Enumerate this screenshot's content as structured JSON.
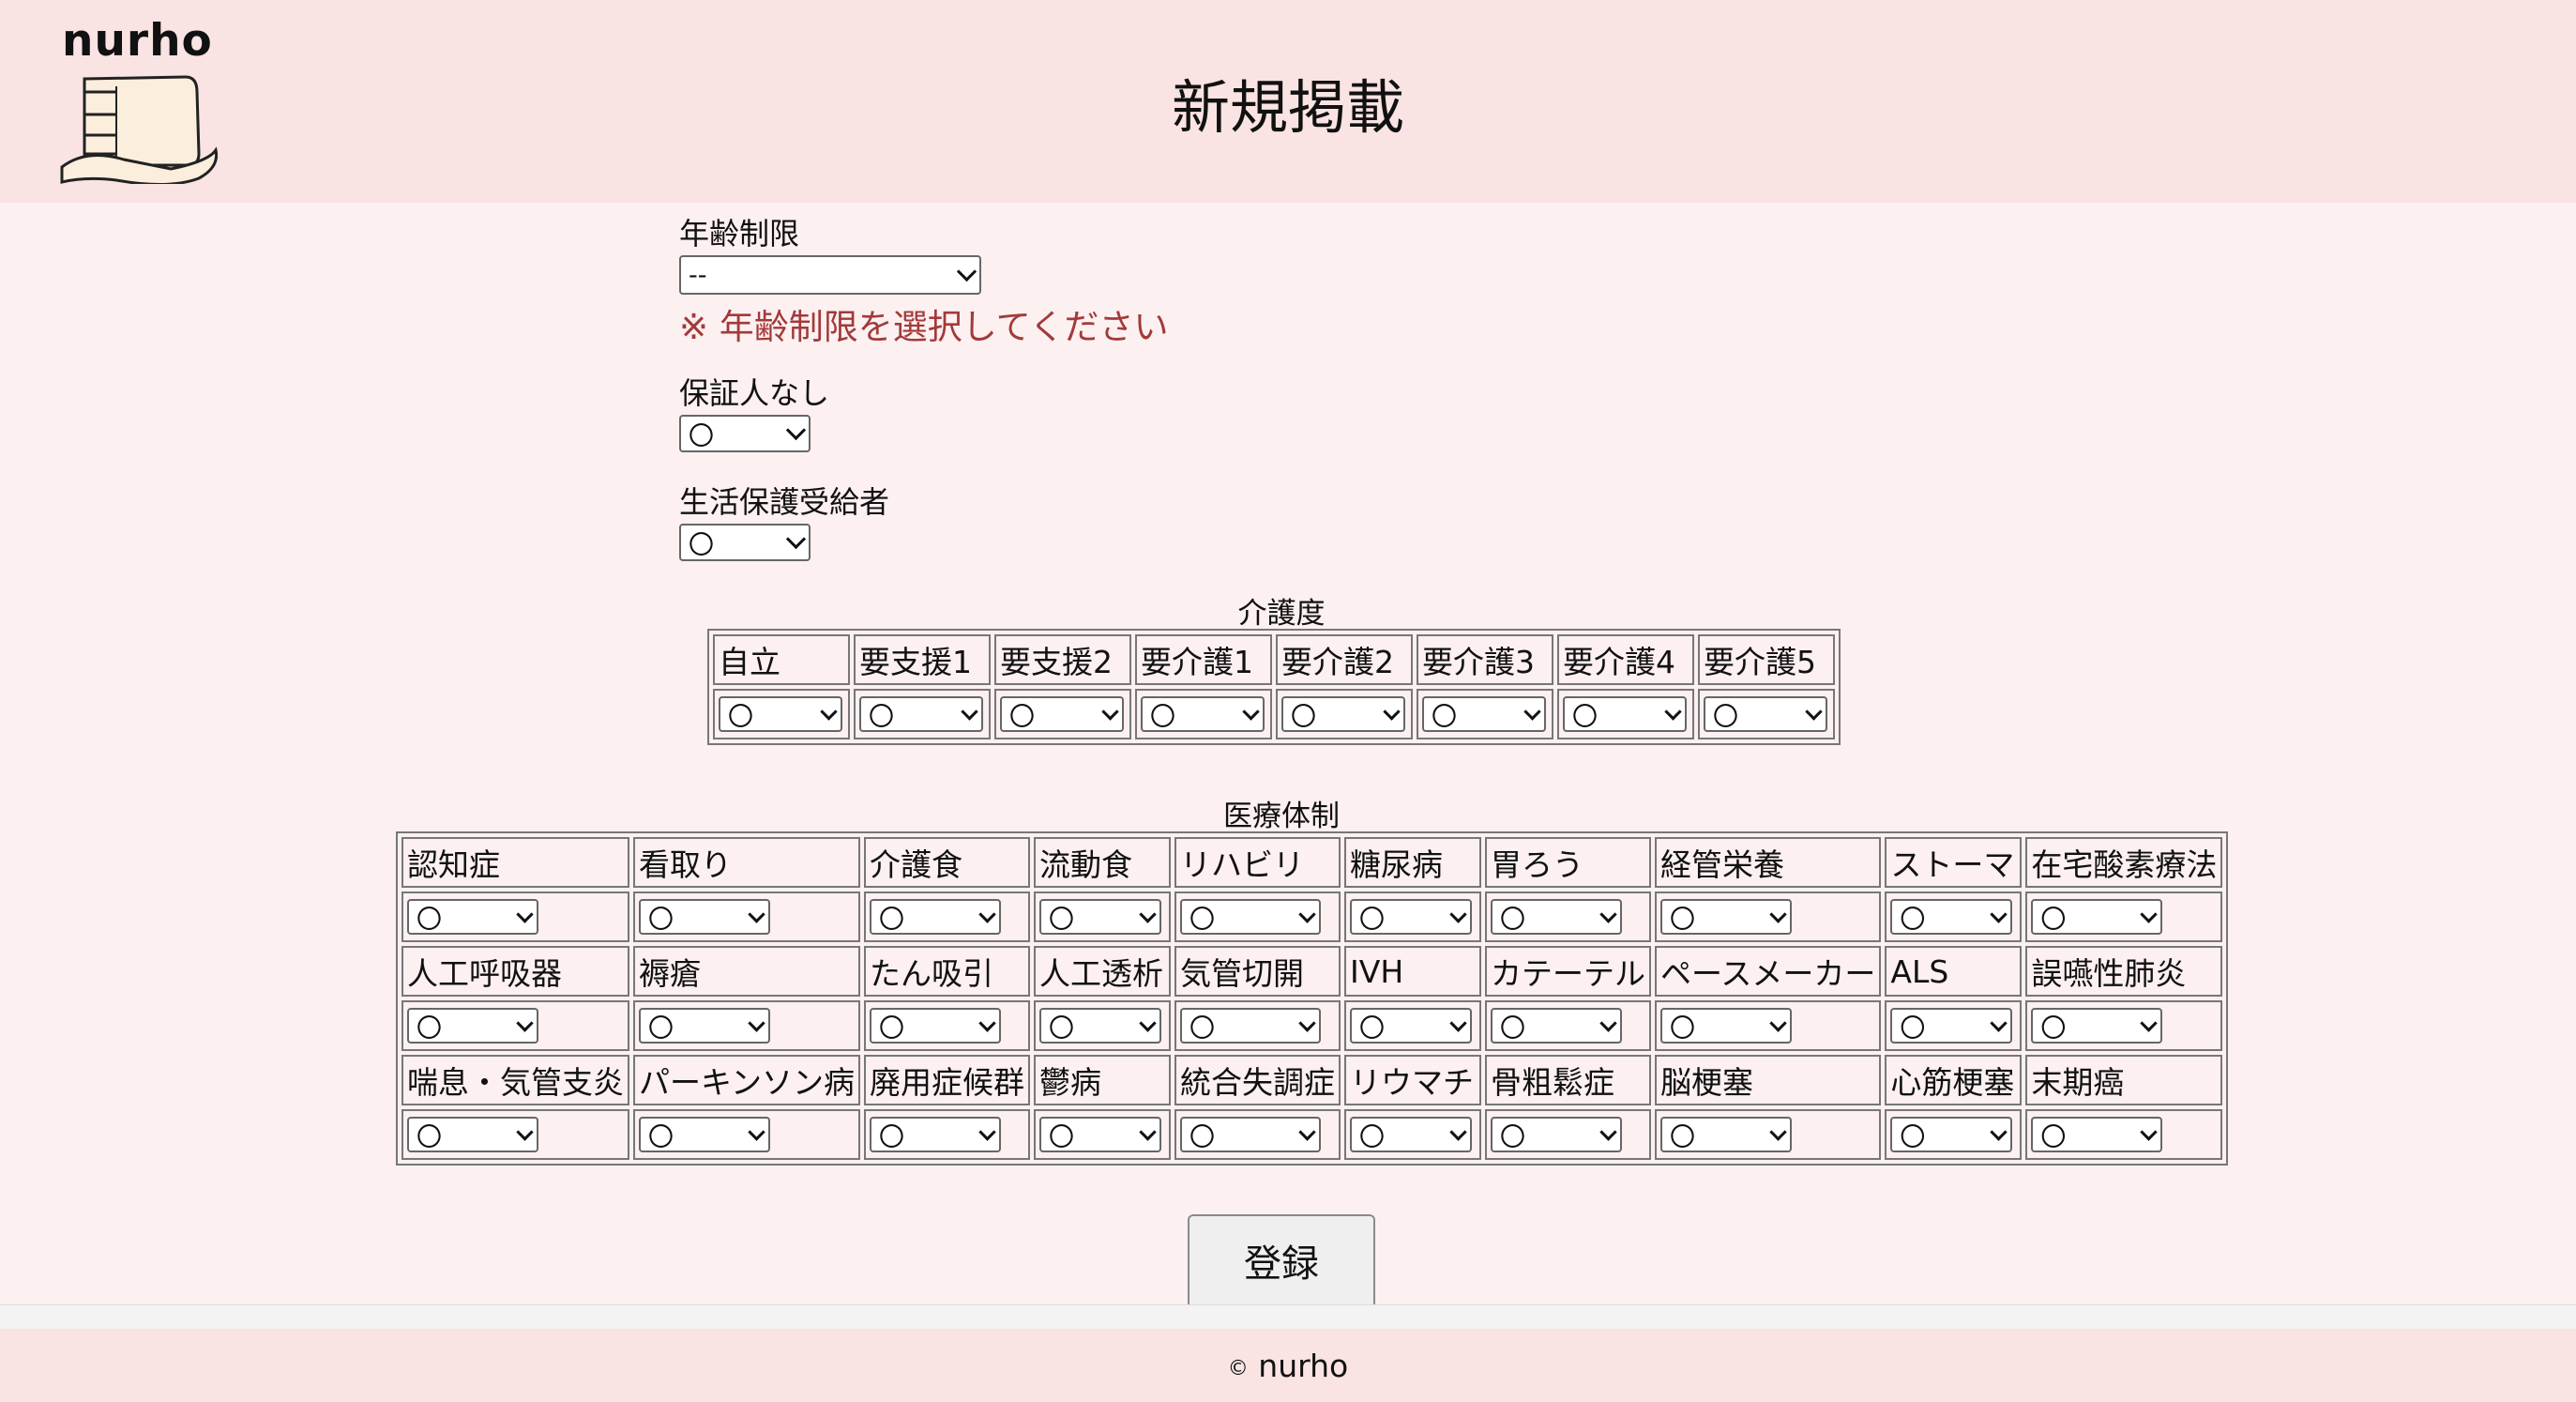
{
  "header": {
    "logo_text": "nurho",
    "title": "新規掲載"
  },
  "form": {
    "age_limit": {
      "label": "年齢制限",
      "value": "--",
      "error": "※ 年齢制限を選択してください"
    },
    "no_guarantor": {
      "label": "保証人なし",
      "value": "〇"
    },
    "welfare": {
      "label": "生活保護受給者",
      "value": "〇"
    }
  },
  "care_level": {
    "caption": "介護度",
    "columns": [
      "自立",
      "要支援1",
      "要支援2",
      "要介護1",
      "要介護2",
      "要介護3",
      "要介護4",
      "要介護5"
    ],
    "values": [
      "〇",
      "〇",
      "〇",
      "〇",
      "〇",
      "〇",
      "〇",
      "〇"
    ]
  },
  "medical": {
    "caption": "医療体制",
    "rows": [
      [
        "認知症",
        "看取り",
        "介護食",
        "流動食",
        "リハビリ",
        "糖尿病",
        "胃ろう",
        "経管栄養",
        "ストーマ",
        "在宅酸素療法"
      ],
      [
        "人工呼吸器",
        "褥瘡",
        "たん吸引",
        "人工透析",
        "気管切開",
        "IVH",
        "カテーテル",
        "ペースメーカー",
        "ALS",
        "誤嚥性肺炎"
      ],
      [
        "喘息・気管支炎",
        "パーキンソン病",
        "廃用症候群",
        "鬱病",
        "統合失調症",
        "リウマチ",
        "骨粗鬆症",
        "脳梗塞",
        "心筋梗塞",
        "末期癌"
      ]
    ],
    "value": "〇"
  },
  "submit_label": "登録",
  "footer": {
    "copyright_symbol": "©",
    "copyright_text": "nurho"
  }
}
